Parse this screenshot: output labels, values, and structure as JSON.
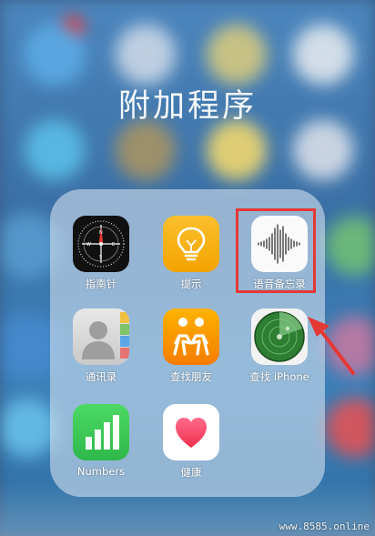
{
  "folder": {
    "title": "附加程序"
  },
  "apps": [
    {
      "label": "指南针",
      "icon": "compass-icon"
    },
    {
      "label": "提示",
      "icon": "lightbulb-icon"
    },
    {
      "label": "语音备忘录",
      "icon": "waveform-icon",
      "highlighted": true
    },
    {
      "label": "通讯录",
      "icon": "contacts-icon"
    },
    {
      "label": "查找朋友",
      "icon": "find-friends-icon"
    },
    {
      "label": "查找 iPhone",
      "icon": "radar-icon"
    },
    {
      "label": "Numbers",
      "icon": "bar-chart-icon"
    },
    {
      "label": "健康",
      "icon": "heart-icon"
    }
  ],
  "annotation": {
    "color": "#e53935"
  },
  "watermark": "www.8585.online"
}
